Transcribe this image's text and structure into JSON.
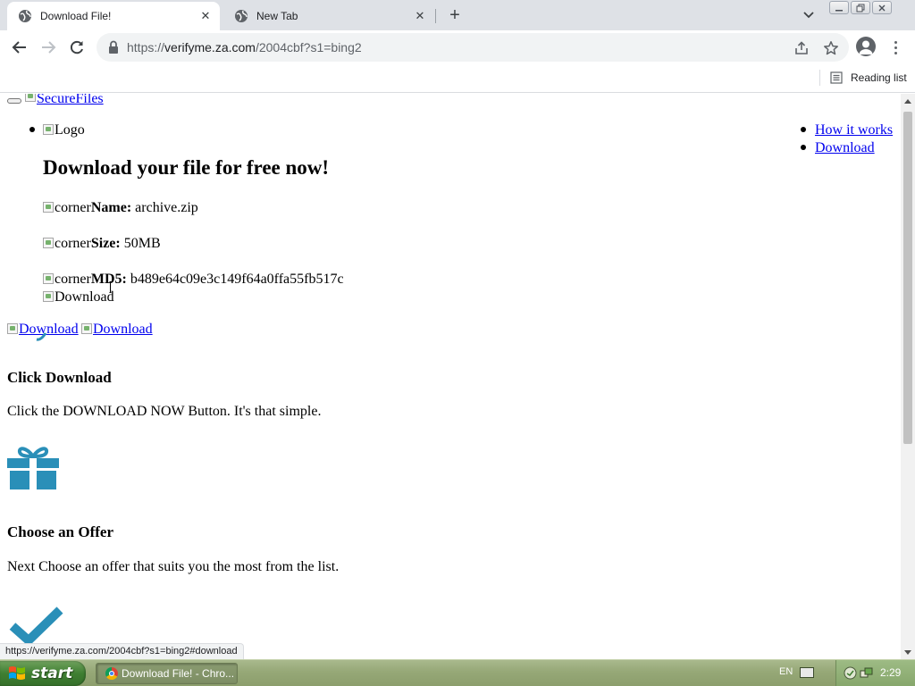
{
  "browser": {
    "tabs": [
      {
        "title": "Download File!",
        "active": true
      },
      {
        "title": "New Tab",
        "active": false
      }
    ],
    "new_tab_symbol": "+",
    "url_prefix": "https://",
    "url_host": "verifyme.za.com",
    "url_path": "/2004cbf?s1=bing2",
    "reading_list_label": "Reading list",
    "window_buttons": [
      "minimize-icon",
      "restore-icon",
      "close-icon"
    ]
  },
  "page": {
    "brand_alt": "SecureFiles",
    "logo_alt": "Logo",
    "nav_links": [
      "How it works",
      "Download"
    ],
    "heading": "Download your file for free now!",
    "file_info": [
      {
        "img_alt": "corner",
        "label": "Name:",
        "value": " archive.zip"
      },
      {
        "img_alt": "corner",
        "label": "Size:",
        "value": " 50MB"
      },
      {
        "img_alt": "corner",
        "label": "MD5:",
        "value": " b489e64c09e3c149f64a0ffa55fb517c"
      }
    ],
    "download_img_alt": "Download",
    "download_links": [
      "Download",
      "Download"
    ],
    "steps": [
      {
        "title": "Click Download",
        "text": "Click the DOWNLOAD NOW Button. It's that simple.",
        "icon": "gift-icon"
      },
      {
        "title": "Choose an Offer",
        "text": "Next Choose an offer that suits you the most from the list.",
        "icon": "checkmark-icon"
      }
    ],
    "accent_color": "#2a8fb8"
  },
  "status_url": "https://verifyme.za.com/2004cbf?s1=bing2#download",
  "taskbar": {
    "start_label": "start",
    "task_item": "Download File! - Chro...",
    "language": "EN",
    "clock": "2:29"
  }
}
